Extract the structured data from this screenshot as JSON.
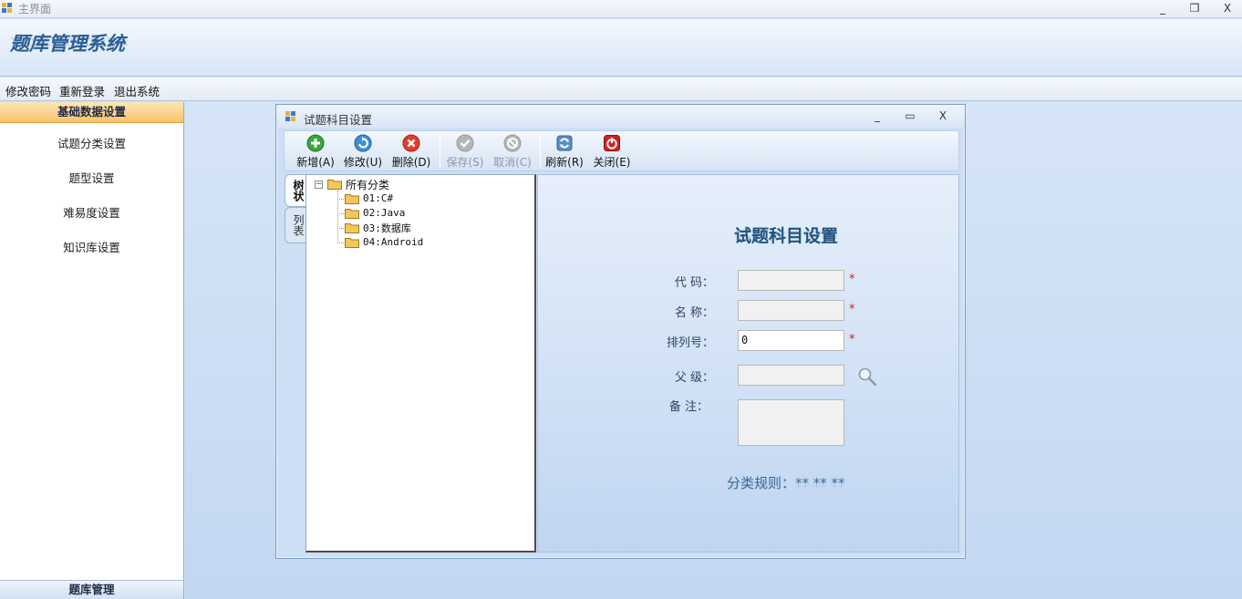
{
  "window": {
    "title": "主界面",
    "minimize": "_",
    "maximize": "❐",
    "close": "X"
  },
  "banner": {
    "logo": "题库管理系统"
  },
  "menu": {
    "items": [
      "修改密码",
      "重新登录",
      "退出系统"
    ]
  },
  "sidebar": {
    "header": "基础数据设置",
    "items": [
      "试题分类设置",
      "题型设置",
      "难易度设置",
      "知识库设置"
    ],
    "footer": "题库管理"
  },
  "child_window": {
    "title": "试题科目设置",
    "minimize": "_",
    "maximize": "▭",
    "close": "X"
  },
  "toolbar": {
    "add": "新增(A)",
    "edit": "修改(U)",
    "delete": "删除(D)",
    "save": "保存(S)",
    "cancel": "取消(C)",
    "refresh": "刷新(R)",
    "close": "关闭(E)",
    "colors": {
      "add": "#3aa63a",
      "edit": "#3d8fd8",
      "delete": "#e23d2a",
      "disabled": "#b6b6b6",
      "close": "#d42020"
    }
  },
  "tabs": {
    "tree": "树状",
    "list": "列表"
  },
  "tree": {
    "root": "所有分类",
    "children": [
      "01:C#",
      "02:Java",
      "03:数据库",
      "04:Android"
    ]
  },
  "form": {
    "title": "试题科目设置",
    "code_label": "代 码：",
    "name_label": "名 称：",
    "order_label": "排列号：",
    "parent_label": "父 级：",
    "remark_label": "备 注：",
    "code_value": "",
    "name_value": "",
    "order_value": "0",
    "parent_value": "",
    "remark_value": "",
    "required_mark": "*",
    "rule": "分类规则：** ** **"
  }
}
